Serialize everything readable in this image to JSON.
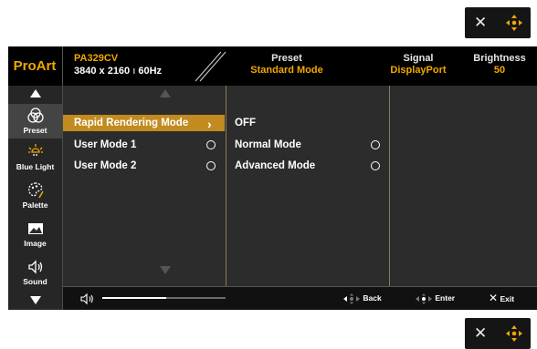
{
  "colors": {
    "accent": "#f0a800",
    "selection": "#c28b1f",
    "osd_bg": "#2c2c2c",
    "header_bg": "#000000"
  },
  "keys_top": {
    "close_icon": "close-icon",
    "nav_icon": "five-way-joystick-icon"
  },
  "keys_bottom": {
    "close_icon": "close-icon",
    "nav_icon": "five-way-joystick-icon"
  },
  "header": {
    "brand": "ProArt",
    "model": "PA329CV",
    "resolution": "3840 x 2160",
    "refresh": "60Hz",
    "preset_label": "Preset",
    "preset_value": "Standard Mode",
    "signal_label": "Signal",
    "signal_value": "DisplayPort",
    "brightness_label": "Brightness",
    "brightness_value": "50"
  },
  "sidebar": {
    "items": [
      {
        "label": "Preset",
        "icon": "preset-icon",
        "active": true
      },
      {
        "label": "Blue Light",
        "icon": "blue-light-icon"
      },
      {
        "label": "Palette",
        "icon": "palette-icon"
      },
      {
        "label": "Image",
        "icon": "image-icon"
      },
      {
        "label": "Sound",
        "icon": "sound-icon"
      }
    ]
  },
  "menu1": {
    "items": [
      {
        "label": "Rapid Rendering Mode",
        "selected": true
      },
      {
        "label": "User Mode 1"
      },
      {
        "label": "User Mode 2"
      }
    ]
  },
  "menu2": {
    "items": [
      {
        "label": "OFF"
      },
      {
        "label": "Normal Mode"
      },
      {
        "label": "Advanced Mode"
      }
    ]
  },
  "footer": {
    "volume_level_fraction": 0.52,
    "back_label": "Back",
    "enter_label": "Enter",
    "exit_label": "Exit"
  }
}
